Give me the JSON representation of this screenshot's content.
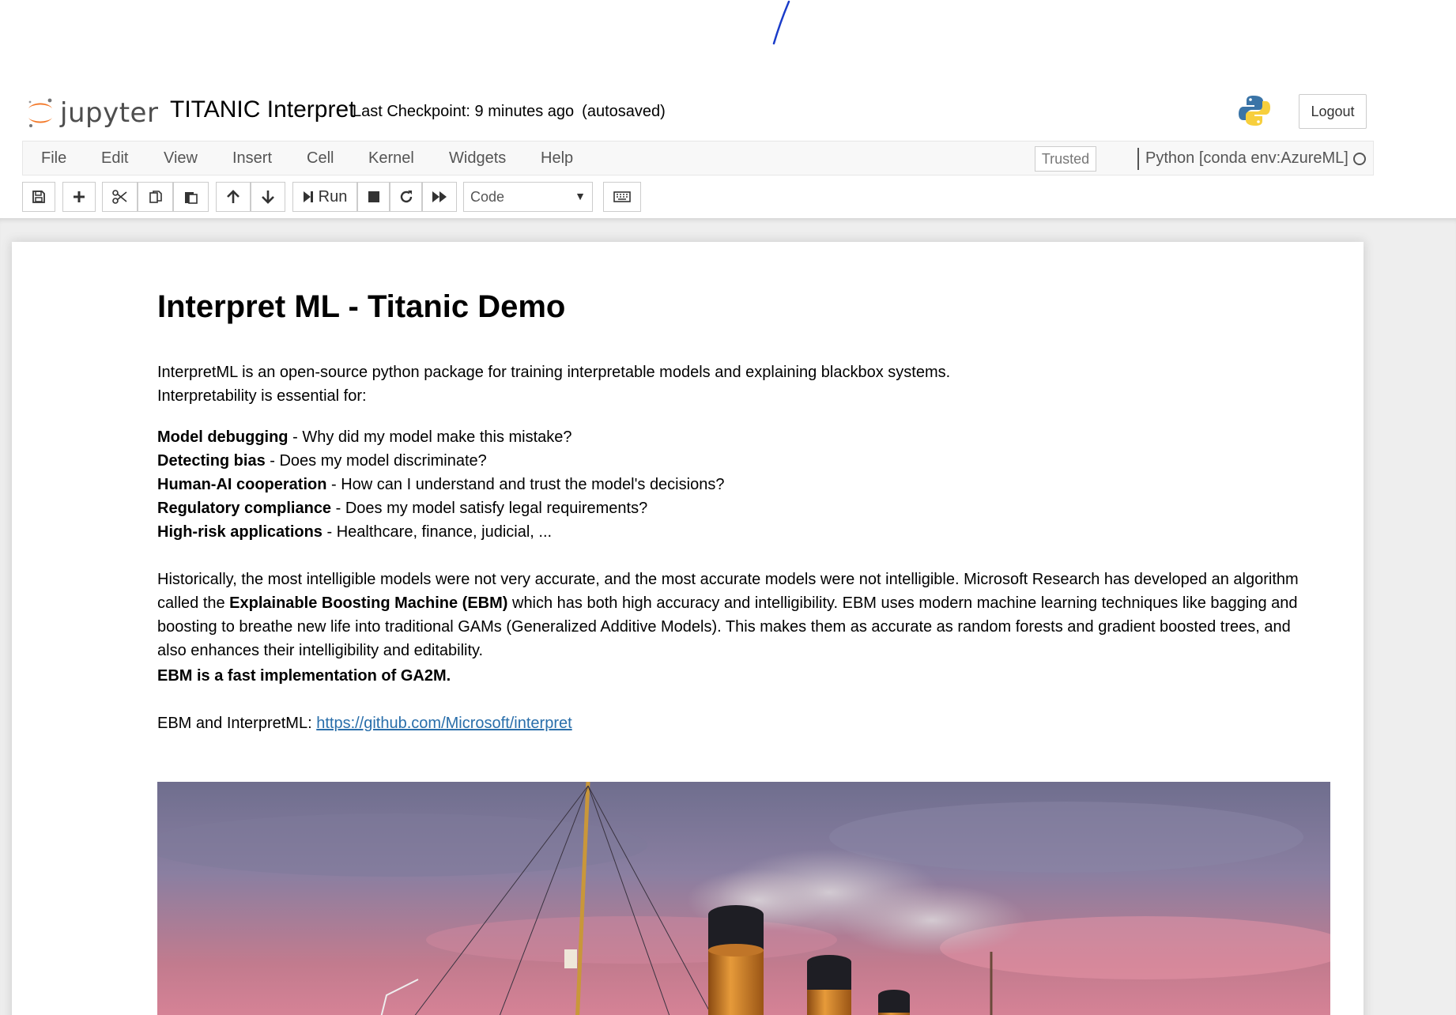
{
  "header": {
    "logo_text": "jupyter",
    "notebook_name": "TITANIC Interpret",
    "checkpoint": "Last Checkpoint: 9 minutes ago",
    "autosave": "(autosaved)",
    "logout_label": "Logout"
  },
  "menubar": {
    "items": [
      "File",
      "Edit",
      "View",
      "Insert",
      "Cell",
      "Kernel",
      "Widgets",
      "Help"
    ],
    "trusted_label": "Trusted",
    "kernel_name": "Python [conda env:AzureML]"
  },
  "toolbar": {
    "run_label": "Run",
    "cell_type": "Code"
  },
  "content": {
    "title": "Interpret ML - Titanic Demo",
    "intro_line1": "InterpretML is an open-source python package for training interpretable models and explaining blackbox systems.",
    "intro_line2": "Interpretability is essential for:",
    "bullets": [
      {
        "term": "Model debugging",
        "sep": " - ",
        "text": "Why did my model make this mistake?"
      },
      {
        "term": "Detecting bias",
        "sep": " - ",
        "text": "Does my model discriminate?"
      },
      {
        "term": "Human-AI cooperation",
        "sep": " - ",
        "text": "How can I understand and trust the model's decisions?"
      },
      {
        "term": "Regulatory compliance",
        "sep": " - ",
        "text": "Does my model satisfy legal requirements?"
      },
      {
        "term": "High-risk applications",
        "sep": " - ",
        "text": "Healthcare, finance, judicial, ..."
      }
    ],
    "history_pre": "Historically, the most intelligible models were not very accurate, and the most accurate models were not intelligible. Microsoft Research has developed an algorithm called the ",
    "history_bold": "Explainable Boosting Machine (EBM)",
    "history_post": " which has both high accuracy and intelligibility. EBM uses modern machine learning techniques like bagging and boosting to breathe new life into traditional GAMs (Generalized Additive Models). This makes them as accurate as random forests and gradient boosted trees, and also enhances their intelligibility and editability.",
    "ebm_statement": "EBM is a fast implementation of GA2M.",
    "link_prefix": "EBM and InterpretML: ",
    "link_text": "https://github.com/Microsoft/interpret"
  },
  "colors": {
    "jupyter_orange": "#f37726",
    "link": "#296eaa",
    "notebook_bg": "#eeeeee"
  }
}
